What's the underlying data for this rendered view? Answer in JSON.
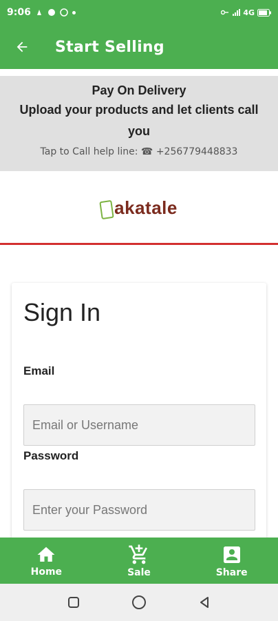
{
  "status_bar": {
    "time": "9:06",
    "indicators": "4G",
    "colors": {
      "bg": "#4caf50"
    }
  },
  "app_bar": {
    "title": "Start Selling",
    "back_icon": "arrow-left-icon"
  },
  "promo": {
    "title": "Pay On Delivery",
    "subtitle": "Upload your products and let clients call you",
    "help_label": "Tap to Call help line:",
    "help_number": "+256779448833"
  },
  "logo": {
    "text": "akatale"
  },
  "signin": {
    "title": "Sign In",
    "email_label": "Email",
    "email_placeholder": "Email or Username",
    "password_label": "Password",
    "password_placeholder": "Enter your Password"
  },
  "bottom_nav": {
    "items": [
      {
        "label": "Home",
        "icon": "home-icon"
      },
      {
        "label": "Sale",
        "icon": "add-to-cart-icon"
      },
      {
        "label": "Share",
        "icon": "share-icon"
      }
    ]
  },
  "system_nav": {
    "icons": [
      "square-icon",
      "circle-icon",
      "back-triangle-icon"
    ]
  },
  "colors": {
    "primary": "#4caf50",
    "promo_bg": "#e0e0e0",
    "divider": "#d32f2f",
    "logo_text": "#7b2b1e",
    "logo_bag": "#7cb342"
  }
}
